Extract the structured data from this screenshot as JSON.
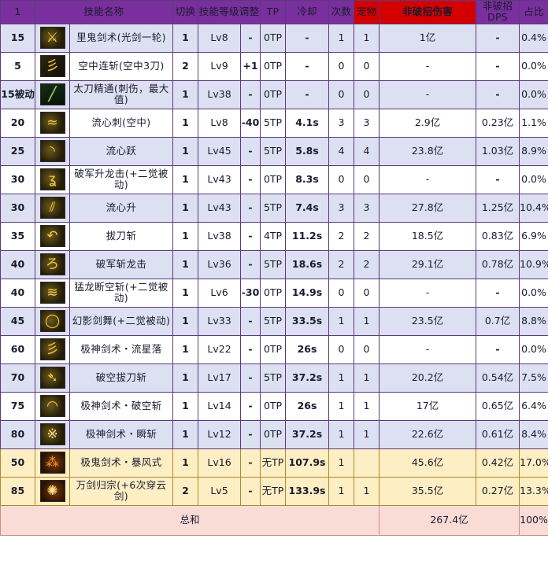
{
  "header": {
    "index": "1",
    "name": "技能名称",
    "switch": "切换",
    "level_adjust": "技能等级调整",
    "tp": "TP",
    "cooldown": "冷却",
    "count": "次数",
    "pet": "宠物",
    "damage": "非破招伤害",
    "dps": "非破招DPS",
    "ratio": "占比"
  },
  "total": {
    "label": "总和",
    "damage": "267.4亿",
    "ratio": "100%"
  },
  "rows": [
    {
      "lvl": "15",
      "icon": "sword-slash-icon",
      "icon_style": "ic-a",
      "glyph": "⚔",
      "name": "里鬼剑术(光剑一轮)",
      "sw": "1",
      "slv": "Lv8",
      "adj": "-",
      "tp": "0TP",
      "cd": "-",
      "cnt": "1",
      "pet": "1",
      "dmg": "1亿",
      "dps": "-",
      "pct": "0.4%",
      "band": "odd"
    },
    {
      "lvl": "5",
      "icon": "aerial-combo-icon",
      "icon_style": "ic-b",
      "glyph": "彡",
      "name": "空中连斩(空中3刀)",
      "sw": "2",
      "slv": "Lv9",
      "adj": "+1",
      "tp": "0TP",
      "cd": "-",
      "cnt": "0",
      "pet": "0",
      "dmg": "-",
      "dps": "-",
      "pct": "0.0%",
      "band": "even"
    },
    {
      "lvl": "15被动",
      "icon": "katana-mastery-icon",
      "icon_style": "ic-d ic-green",
      "glyph": "╱",
      "name": "太刀精通(刺伤，最大值)",
      "sw": "1",
      "slv": "Lv38",
      "adj": "-",
      "tp": "0TP",
      "cd": "-",
      "cnt": "0",
      "pet": "0",
      "dmg": "-",
      "dps": "-",
      "pct": "0.0%",
      "band": "odd"
    },
    {
      "lvl": "20",
      "icon": "flow-thrust-icon",
      "icon_style": "ic-a",
      "glyph": "≈",
      "name": "流心刺(空中)",
      "sw": "1",
      "slv": "Lv8",
      "adj": "-40",
      "tp": "5TP",
      "cd": "4.1s",
      "cnt": "3",
      "pet": "3",
      "dmg": "2.9亿",
      "dps": "0.23亿",
      "pct": "1.1%",
      "band": "even"
    },
    {
      "lvl": "25",
      "icon": "flow-leap-icon",
      "icon_style": "ic-a",
      "glyph": "◝",
      "name": "流心跃",
      "sw": "1",
      "slv": "Lv45",
      "adj": "-",
      "tp": "5TP",
      "cd": "5.8s",
      "cnt": "4",
      "pet": "4",
      "dmg": "23.8亿",
      "dps": "1.03亿",
      "pct": "8.9%",
      "band": "odd"
    },
    {
      "lvl": "30",
      "icon": "rising-dragon-icon",
      "icon_style": "ic-a",
      "glyph": "ʓ",
      "name": "破军升龙击(+二觉被动)",
      "sw": "1",
      "slv": "Lv43",
      "adj": "-",
      "tp": "0TP",
      "cd": "8.3s",
      "cnt": "0",
      "pet": "0",
      "dmg": "-",
      "dps": "-",
      "pct": "0.0%",
      "band": "even"
    },
    {
      "lvl": "30",
      "icon": "flow-rise-icon",
      "icon_style": "ic-a",
      "glyph": "⫽",
      "name": "流心升",
      "sw": "1",
      "slv": "Lv43",
      "adj": "-",
      "tp": "5TP",
      "cd": "7.4s",
      "cnt": "3",
      "pet": "3",
      "dmg": "27.8亿",
      "dps": "1.25亿",
      "pct": "10.4%",
      "band": "odd"
    },
    {
      "lvl": "35",
      "icon": "draw-sword-icon",
      "icon_style": "ic-a",
      "glyph": "↶",
      "name": "拔刀斩",
      "sw": "1",
      "slv": "Lv38",
      "adj": "-",
      "tp": "4TP",
      "cd": "11.2s",
      "cnt": "2",
      "pet": "2",
      "dmg": "18.5亿",
      "dps": "0.83亿",
      "pct": "6.9%",
      "band": "even"
    },
    {
      "lvl": "40",
      "icon": "dragon-slash-icon",
      "icon_style": "ic-a",
      "glyph": "ろ",
      "name": "破军斩龙击",
      "sw": "1",
      "slv": "Lv36",
      "adj": "-",
      "tp": "5TP",
      "cd": "18.6s",
      "cnt": "2",
      "pet": "2",
      "dmg": "29.1亿",
      "dps": "0.78亿",
      "pct": "10.9%",
      "band": "odd"
    },
    {
      "lvl": "40",
      "icon": "fierce-dragon-icon",
      "icon_style": "ic-a",
      "glyph": "≋",
      "name": "猛龙断空斩(+二觉被动)",
      "sw": "1",
      "slv": "Lv6",
      "adj": "-30",
      "tp": "0TP",
      "cd": "14.9s",
      "cnt": "0",
      "pet": "0",
      "dmg": "-",
      "dps": "-",
      "pct": "0.0%",
      "band": "even"
    },
    {
      "lvl": "45",
      "icon": "phantom-dance-icon",
      "icon_style": "ic-a",
      "glyph": "◯",
      "name": "幻影剑舞(+二觉被动)",
      "sw": "1",
      "slv": "Lv33",
      "adj": "-",
      "tp": "5TP",
      "cd": "33.5s",
      "cnt": "1",
      "pet": "1",
      "dmg": "23.5亿",
      "dps": "0.7亿",
      "pct": "8.8%",
      "band": "odd"
    },
    {
      "lvl": "60",
      "icon": "meteor-fall-icon",
      "icon_style": "ic-a",
      "glyph": "彡",
      "name": "极神剑术・流星落",
      "sw": "1",
      "slv": "Lv22",
      "adj": "-",
      "tp": "0TP",
      "cd": "26s",
      "cnt": "0",
      "pet": "0",
      "dmg": "-",
      "dps": "-",
      "pct": "0.0%",
      "band": "even"
    },
    {
      "lvl": "70",
      "icon": "air-draw-slash-icon",
      "icon_style": "ic-a",
      "glyph": "➴",
      "name": "破空拔刀斩",
      "sw": "1",
      "slv": "Lv17",
      "adj": "-",
      "tp": "5TP",
      "cd": "37.2s",
      "cnt": "1",
      "pet": "1",
      "dmg": "20.2亿",
      "dps": "0.54亿",
      "pct": "7.5%",
      "band": "odd"
    },
    {
      "lvl": "75",
      "icon": "air-break-slash-icon",
      "icon_style": "ic-a",
      "glyph": "◠",
      "name": "极神剑术・破空斩",
      "sw": "1",
      "slv": "Lv14",
      "adj": "-",
      "tp": "0TP",
      "cd": "26s",
      "cnt": "1",
      "pet": "1",
      "dmg": "17亿",
      "dps": "0.65亿",
      "pct": "6.4%",
      "band": "even"
    },
    {
      "lvl": "80",
      "icon": "flash-slash-icon",
      "icon_style": "ic-a ic-pale",
      "glyph": "※",
      "name": "极神剑术・瞬斩",
      "sw": "1",
      "slv": "Lv12",
      "adj": "-",
      "tp": "0TP",
      "cd": "37.2s",
      "cnt": "1",
      "pet": "1",
      "dmg": "22.6亿",
      "dps": "0.61亿",
      "pct": "8.4%",
      "band": "odd"
    },
    {
      "lvl": "50",
      "icon": "storm-style-icon",
      "icon_style": "ic-c ic-red",
      "glyph": "⁂",
      "name": "极鬼剑术・暴风式",
      "sw": "1",
      "slv": "Lv16",
      "adj": "-",
      "tp": "无TP",
      "cd": "107.9s",
      "cnt": "1",
      "pet": "",
      "dmg": "45.6亿",
      "dps": "0.42亿",
      "pct": "17.0%",
      "band": "awk"
    },
    {
      "lvl": "85",
      "icon": "thousand-swords-icon",
      "icon_style": "ic-c ic-pale",
      "glyph": "✺",
      "name": "万剑归宗(+6次穿云剑)",
      "sw": "2",
      "slv": "Lv5",
      "adj": "-",
      "tp": "无TP",
      "cd": "133.9s",
      "cnt": "1",
      "pet": "1",
      "dmg": "35.5亿",
      "dps": "0.27亿",
      "pct": "13.3%",
      "band": "awk"
    }
  ]
}
